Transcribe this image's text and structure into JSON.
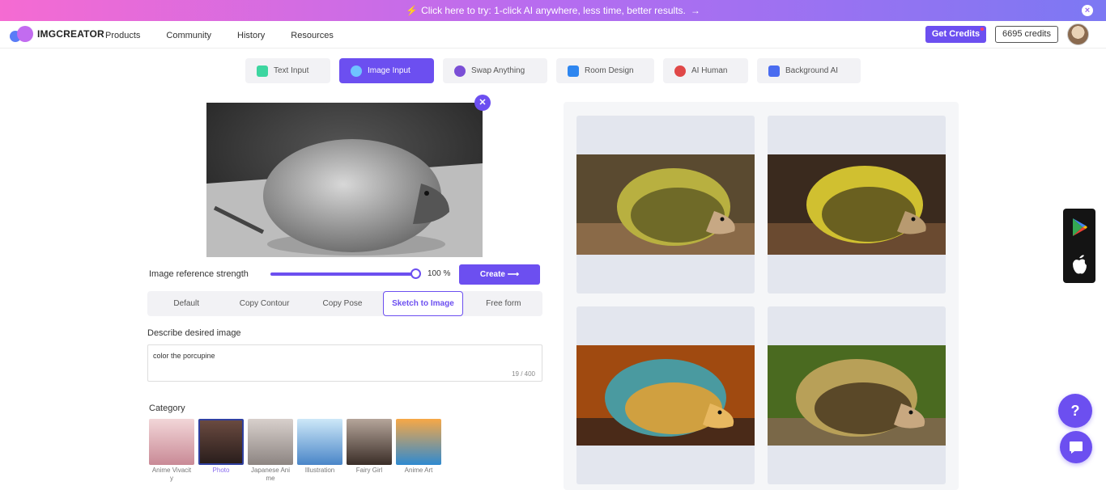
{
  "banner": {
    "icon": "lightning-icon",
    "text": "Click here to try: 1-click AI anywhere, less time, better results.",
    "arrow": "→",
    "close": "×"
  },
  "nav": {
    "logo_text": "IMGCREATOR",
    "menu": [
      "Products",
      "Community",
      "History",
      "Resources"
    ],
    "get_credits": "Get Credits",
    "credits": "6695 credits"
  },
  "tabs": [
    {
      "label": "Text Input",
      "icon": "text-t-icon",
      "color": "#3dd6a0"
    },
    {
      "label": "Image Input",
      "icon": "image-icon",
      "color": "#6fc3ff"
    },
    {
      "label": "Swap Anything",
      "icon": "swap-icon",
      "color": "#7b4fd6"
    },
    {
      "label": "Room Design",
      "icon": "house-icon",
      "color": "#2e86f0"
    },
    {
      "label": "AI Human",
      "icon": "person-icon",
      "color": "#e04848"
    },
    {
      "label": "Background AI",
      "icon": "background-icon",
      "color": "#4a6cf0"
    }
  ],
  "controls": {
    "strength_label": "Image reference strength",
    "strength_value": 1.0,
    "strength_text": "100 %",
    "create_label": "Create",
    "create_arrow": "⟶"
  },
  "modes": [
    "Default",
    "Copy Contour",
    "Copy Pose",
    "Sketch to Image",
    "Free form"
  ],
  "active_mode": "Sketch to Image",
  "describe": {
    "label": "Describe desired image",
    "value": "color the porcupine",
    "count": "19 / 400"
  },
  "category": {
    "label": "Category",
    "items": [
      {
        "name": "Anime Vivacit\ny",
        "color": "#d9a0a8"
      },
      {
        "name": "Photo",
        "color": "#4a3430"
      },
      {
        "name": "Japanese Ani\nme",
        "color": "#b8b0b0"
      },
      {
        "name": "Illustration",
        "color": "#8ec4ea"
      },
      {
        "name": "Fairy Girl",
        "color": "#6d5a50"
      },
      {
        "name": "Anime Art",
        "color": "#f0902a"
      }
    ]
  },
  "accent": "#6c4ff0",
  "help_label": "?"
}
